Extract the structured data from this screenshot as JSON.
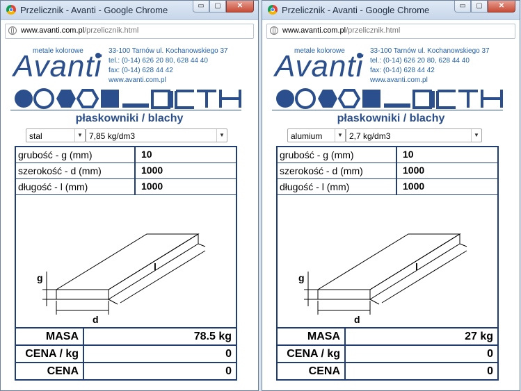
{
  "windows": [
    {
      "title": "Przelicznik - Avanti - Google Chrome",
      "url_host": "www.avanti.com.pl",
      "url_path": "/przelicznik.html",
      "logo_sub": "metale kolorowe",
      "logo_main": "Avanti",
      "contact": [
        "33-100 Tarnów ul. Kochanowskiego 37",
        "tel.: (0-14) 626 20 80, 628 44 40",
        "fax: (0-14) 628 44 42",
        "www.avanti.com.pl"
      ],
      "subtitle": "płaskowniki / blachy",
      "material": "stal",
      "density": "7,85 kg/dm3",
      "fields": [
        {
          "label": "grubość - g (mm)",
          "value": "10"
        },
        {
          "label": "szerokość - d (mm)",
          "value": "1000"
        },
        {
          "label": "długość - l (mm)",
          "value": "1000"
        }
      ],
      "diagram_labels": {
        "g": "g",
        "d": "d",
        "l": "l"
      },
      "results": [
        {
          "label": "MASA",
          "value": "78.5 kg"
        },
        {
          "label": "CENA / kg",
          "value": "0"
        },
        {
          "label": "CENA",
          "value": "0"
        }
      ]
    },
    {
      "title": "Przelicznik - Avanti - Google Chrome",
      "url_host": "www.avanti.com.pl",
      "url_path": "/przelicznik.html",
      "logo_sub": "metale kolorowe",
      "logo_main": "Avanti",
      "contact": [
        "33-100 Tarnów ul. Kochanowskiego 37",
        "tel.: (0-14) 626 20 80, 628 44 40",
        "fax: (0-14) 628 44 42",
        "www.avanti.com.pl"
      ],
      "subtitle": "płaskowniki / blachy",
      "material": "alumium",
      "density": "2,7 kg/dm3",
      "fields": [
        {
          "label": "grubość - g (mm)",
          "value": "10"
        },
        {
          "label": "szerokość - d (mm)",
          "value": "1000"
        },
        {
          "label": "długość - l (mm)",
          "value": "1000"
        }
      ],
      "diagram_labels": {
        "g": "g",
        "d": "d",
        "l": "l"
      },
      "results": [
        {
          "label": "MASA",
          "value": "27 kg"
        },
        {
          "label": "CENA / kg",
          "value": "0"
        },
        {
          "label": "CENA",
          "value": "0"
        }
      ]
    }
  ],
  "window_buttons": {
    "minimize": "▭",
    "maximize": "▢",
    "close": "✕"
  },
  "icons": [
    "chrome-icon",
    "globe-icon",
    "chevron-down-icon"
  ],
  "colors": {
    "brand_blue": "#2a4f8c",
    "table_border": "#1f3d72",
    "link_blue": "#2360a5"
  }
}
